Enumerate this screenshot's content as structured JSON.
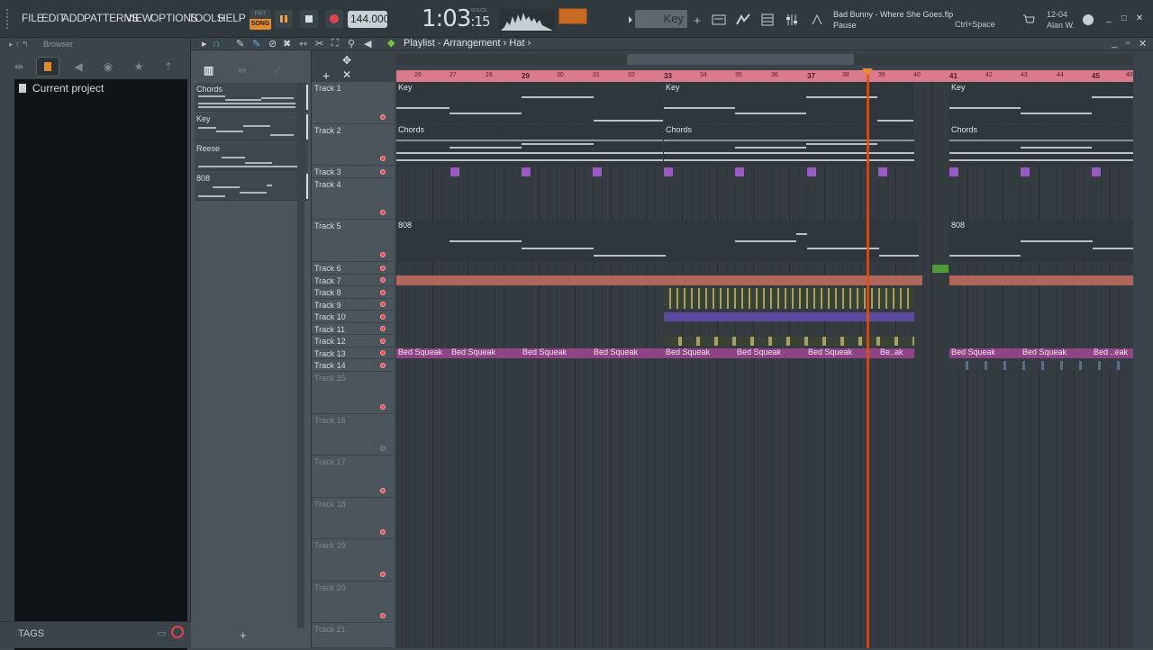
{
  "menu": [
    "FILE",
    "EDIT",
    "ADD",
    "PATTERNS",
    "VIEW",
    "OPTIONS",
    "TOOLS",
    "HELP"
  ],
  "transport": {
    "pat_label": "PAT",
    "song_label": "SONG",
    "tempo": "144.000",
    "time_main": "1:03",
    "time_sub": "15",
    "time_unit": "M:S:CS"
  },
  "key_label": "Key",
  "song": {
    "file": "Bad Bunny - Where She Goes.flp",
    "status": "Pause",
    "shortcut": "Ctrl+Space"
  },
  "user": {
    "date": "12-04",
    "name": "Alan W."
  },
  "browser": {
    "title": "Browser",
    "current": "Current project",
    "tags": "TAGS"
  },
  "patterns": [
    {
      "name": "Chords"
    },
    {
      "name": "Key"
    },
    {
      "name": "Reese"
    },
    {
      "name": "808"
    }
  ],
  "playlist": {
    "title": "Playlist - Arrangement",
    "crumb": "Hat"
  },
  "ruler": [
    "26",
    "27",
    "28",
    "29",
    "30",
    "31",
    "32",
    "33",
    "34",
    "35",
    "36",
    "37",
    "38",
    "39",
    "40",
    "41",
    "42",
    "43",
    "44",
    "45",
    "46"
  ],
  "tracks": [
    "Track 1",
    "Track 2",
    "Track 3",
    "Track 4",
    "Track 5",
    "Track 6",
    "Track 7",
    "Track 8",
    "Track 9",
    "Track 10",
    "Track 11",
    "Track 12",
    "Track 13",
    "Track 14",
    "Track 15",
    "Track 16",
    "Track 17",
    "Track 18",
    "Track 19",
    "Track 20",
    "Track 21"
  ],
  "clips": {
    "key": "Key",
    "chords": "Chords",
    "bass": "808",
    "squeak": "Bed Squeak",
    "squeak_short": "Be..ak",
    "squeak_end": "Bed ..eak"
  },
  "colors": {
    "accent": "#e08a2e",
    "ruler": "#d97b8c",
    "playhead": "#d2551f",
    "squeak": "#9a4a8e",
    "track7": "#c36a5a",
    "track10": "#6a58b8",
    "track8": "#a8a060"
  }
}
